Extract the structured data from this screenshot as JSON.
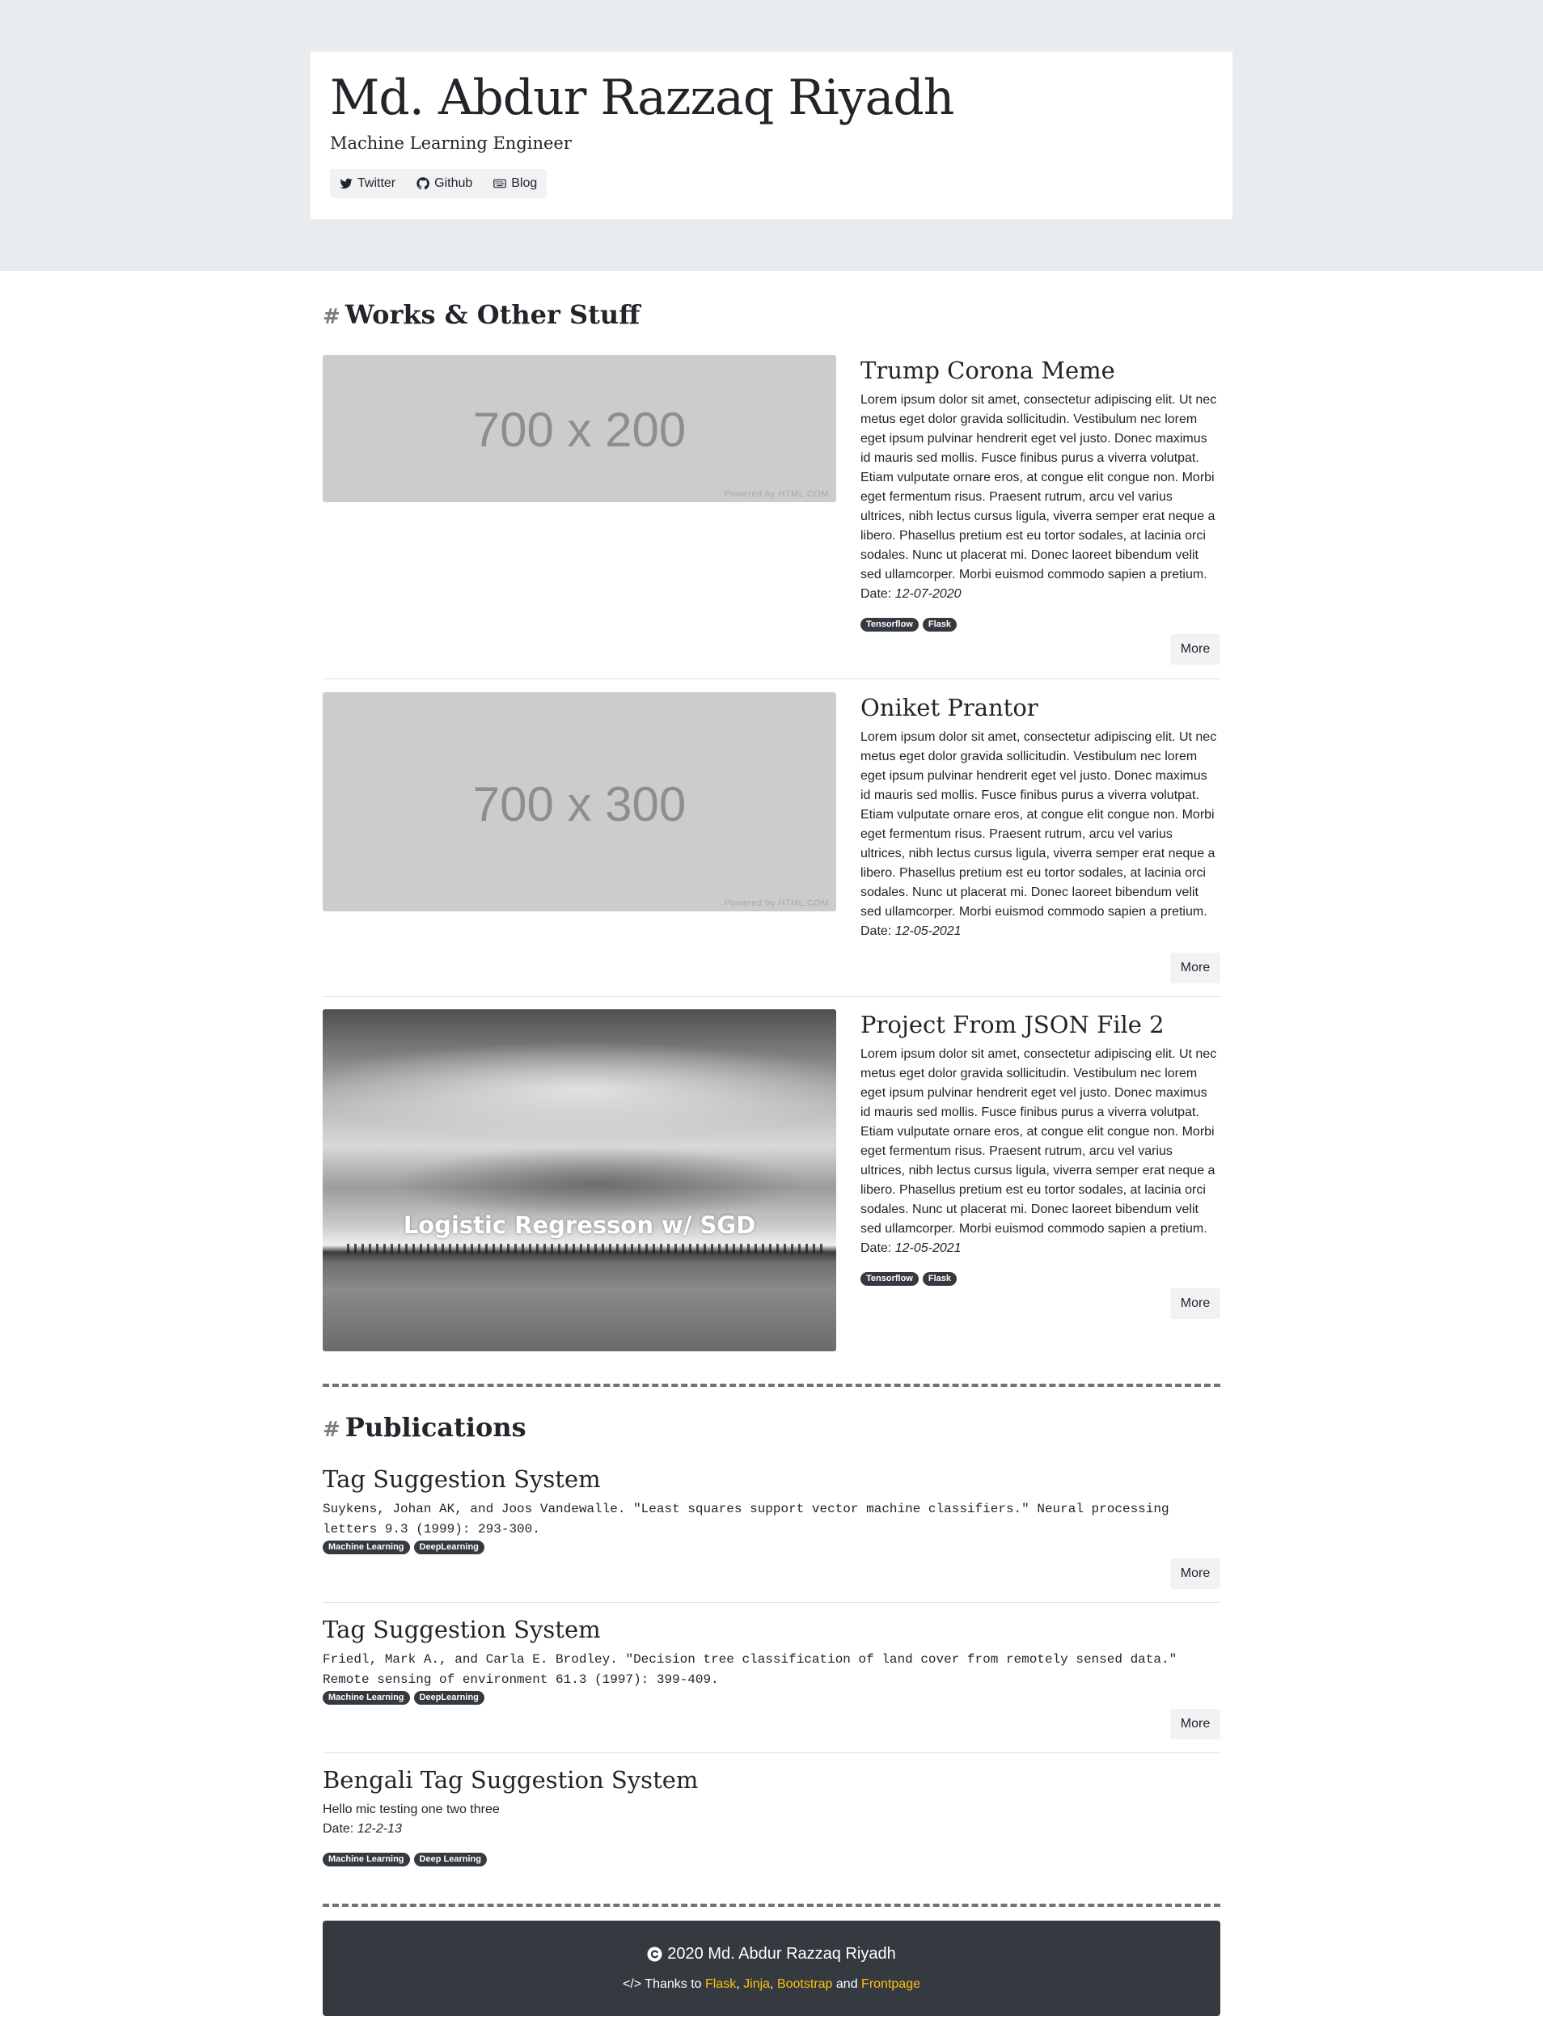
{
  "header": {
    "name": "Md. Abdur Razzaq Riyadh",
    "role": "Machine Learning Engineer",
    "links": [
      {
        "label": "Twitter",
        "icon": "twitter-icon"
      },
      {
        "label": "Github",
        "icon": "github-icon"
      },
      {
        "label": "Blog",
        "icon": "keyboard-icon"
      }
    ]
  },
  "works": {
    "heading_hash": "#",
    "heading": "Works & Other Stuff",
    "items": [
      {
        "title": "Trump Corona Meme",
        "image_text": "700 x 200",
        "image_credit": "Powered by HTML.COM",
        "description": "Lorem ipsum dolor sit amet, consectetur adipiscing elit. Ut nec metus eget dolor gravida sollicitudin. Vestibulum nec lorem eget ipsum pulvinar hendrerit eget vel justo. Donec maximus id mauris sed mollis. Fusce finibus purus a viverra volutpat. Etiam vulputate ornare eros, at congue elit congue non. Morbi eget fermentum risus. Praesent rutrum, arcu vel varius ultrices, nibh lectus cursus ligula, viverra semper erat neque a libero. Phasellus pretium est eu tortor sodales, at lacinia orci sodales. Nunc ut placerat mi. Donec laoreet bibendum velit sed ullamcorper. Morbi euismod commodo sapien a pretium.",
        "date_label": "Date:",
        "date": "12-07-2020",
        "tags": [
          "Tensorflow",
          "Flask"
        ],
        "more": "More"
      },
      {
        "title": "Oniket Prantor",
        "image_text": "700 x 300",
        "image_credit": "Powered by HTML.COM",
        "description": "Lorem ipsum dolor sit amet, consectetur adipiscing elit. Ut nec metus eget dolor gravida sollicitudin. Vestibulum nec lorem eget ipsum pulvinar hendrerit eget vel justo. Donec maximus id mauris sed mollis. Fusce finibus purus a viverra volutpat. Etiam vulputate ornare eros, at congue elit congue non. Morbi eget fermentum risus. Praesent rutrum, arcu vel varius ultrices, nibh lectus cursus ligula, viverra semper erat neque a libero. Phasellus pretium est eu tortor sodales, at lacinia orci sodales. Nunc ut placerat mi. Donec laoreet bibendum velit sed ullamcorper. Morbi euismod commodo sapien a pretium.",
        "date_label": "Date:",
        "date": "12-05-2021",
        "tags": [],
        "more": "More"
      },
      {
        "title": "Project From JSON File 2",
        "image_caption": "Logistic Regresson w/ SGD",
        "description": "Lorem ipsum dolor sit amet, consectetur adipiscing elit. Ut nec metus eget dolor gravida sollicitudin. Vestibulum nec lorem eget ipsum pulvinar hendrerit eget vel justo. Donec maximus id mauris sed mollis. Fusce finibus purus a viverra volutpat. Etiam vulputate ornare eros, at congue elit congue non. Morbi eget fermentum risus. Praesent rutrum, arcu vel varius ultrices, nibh lectus cursus ligula, viverra semper erat neque a libero. Phasellus pretium est eu tortor sodales, at lacinia orci sodales. Nunc ut placerat mi. Donec laoreet bibendum velit sed ullamcorper. Morbi euismod commodo sapien a pretium.",
        "date_label": "Date:",
        "date": "12-05-2021",
        "tags": [
          "Tensorflow",
          "Flask"
        ],
        "more": "More"
      }
    ]
  },
  "publications": {
    "heading_hash": "#",
    "heading": "Publications",
    "items": [
      {
        "title": "Tag Suggestion System",
        "citation": "Suykens, Johan AK, and Joos Vandewalle. \"Least squares support vector machine classifiers.\" Neural processing letters 9.3 (1999): 293-300.",
        "tags": [
          "Machine Learning",
          "DeepLearning"
        ],
        "more": "More"
      },
      {
        "title": "Tag Suggestion System",
        "citation": "Friedl, Mark A., and Carla E. Brodley. \"Decision tree classification of land cover from remotely sensed data.\" Remote sensing of environment 61.3 (1997): 399-409.",
        "tags": [
          "Machine Learning",
          "DeepLearning"
        ],
        "more": "More"
      },
      {
        "title": "Bengali Tag Suggestion System",
        "text": "Hello mic testing one two three",
        "date_label": "Date:",
        "date": "12-2-13",
        "tags": [
          "Machine Learning",
          "Deep Learning"
        ]
      }
    ]
  },
  "footer": {
    "copyright": "2020 Md. Abdur Razzaq Riyadh",
    "thanks_prefix": "</> Thanks to",
    "links": [
      "Flask",
      "Jinja",
      "Bootstrap",
      "Frontpage"
    ],
    "sep1": ",",
    "sep2": ",",
    "sep3": "and",
    "link_color": "#ffc107"
  },
  "colors": {
    "jumbotron_bg": "#e9ecef",
    "badge_bg": "#343a40",
    "footer_bg": "#343a40"
  }
}
